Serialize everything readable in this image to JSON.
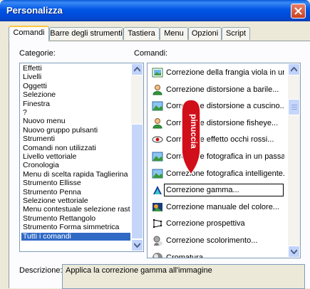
{
  "window": {
    "title": "Personalizza"
  },
  "tabs": [
    {
      "label": "Comandi"
    },
    {
      "label": "Barre degli strumenti"
    },
    {
      "label": "Tastiera"
    },
    {
      "label": "Menu"
    },
    {
      "label": "Opzioni"
    },
    {
      "label": "Script"
    }
  ],
  "categories": {
    "label": "Categorie:",
    "items": [
      "Effetti",
      "Livelli",
      "Oggetti",
      "Selezione",
      "Finestra",
      "?",
      "Nuovo menu",
      "Nuovo gruppo pulsanti",
      "Strumenti",
      "Comandi non utilizzati",
      "Livello vettoriale",
      "Cronologia",
      "Menu di scelta rapida Taglierina",
      "Strumento Ellisse",
      "Strumento Penna",
      "Selezione vettoriale",
      "Menu contestuale selezione rast",
      "Strumento Rettangolo",
      "Strumento Forma simmetrica",
      "Tutti i comandi"
    ],
    "selected": "Tutti i comandi"
  },
  "commands": {
    "label": "Comandi:",
    "items": [
      {
        "label": "Correzione della frangia viola in un p",
        "icon": "photo-frame-icon"
      },
      {
        "label": "Correzione distorsione a barile...",
        "icon": "green-person-icon"
      },
      {
        "label": "Correzione distorsione a cuscino...",
        "icon": "landscape-icon"
      },
      {
        "label": "Correzione distorsione fisheye...",
        "icon": "green-person-icon"
      },
      {
        "label": "Correzione effetto occhi rossi...",
        "icon": "red-eye-icon"
      },
      {
        "label": "Correzione fotografica in un passag",
        "icon": "landscape-icon"
      },
      {
        "label": "Correzione fotografica intelligente...",
        "icon": "landscape-icon"
      },
      {
        "label": "Correzione gamma...",
        "icon": "gamma-icon"
      },
      {
        "label": "Correzione manuale del colore...",
        "icon": "color-photo-icon"
      },
      {
        "label": "Correzione prospettiva",
        "icon": "perspective-icon"
      },
      {
        "label": "Correzione scolorimento...",
        "icon": "fade-icon"
      },
      {
        "label": "Cromatura...",
        "icon": "chrome-sphere-icon"
      }
    ],
    "selected": "Correzione gamma..."
  },
  "description": {
    "label": "Descrizione:",
    "text": "Applica la correzione gamma all'immagine"
  },
  "watermark": {
    "text": "pinuccia"
  }
}
